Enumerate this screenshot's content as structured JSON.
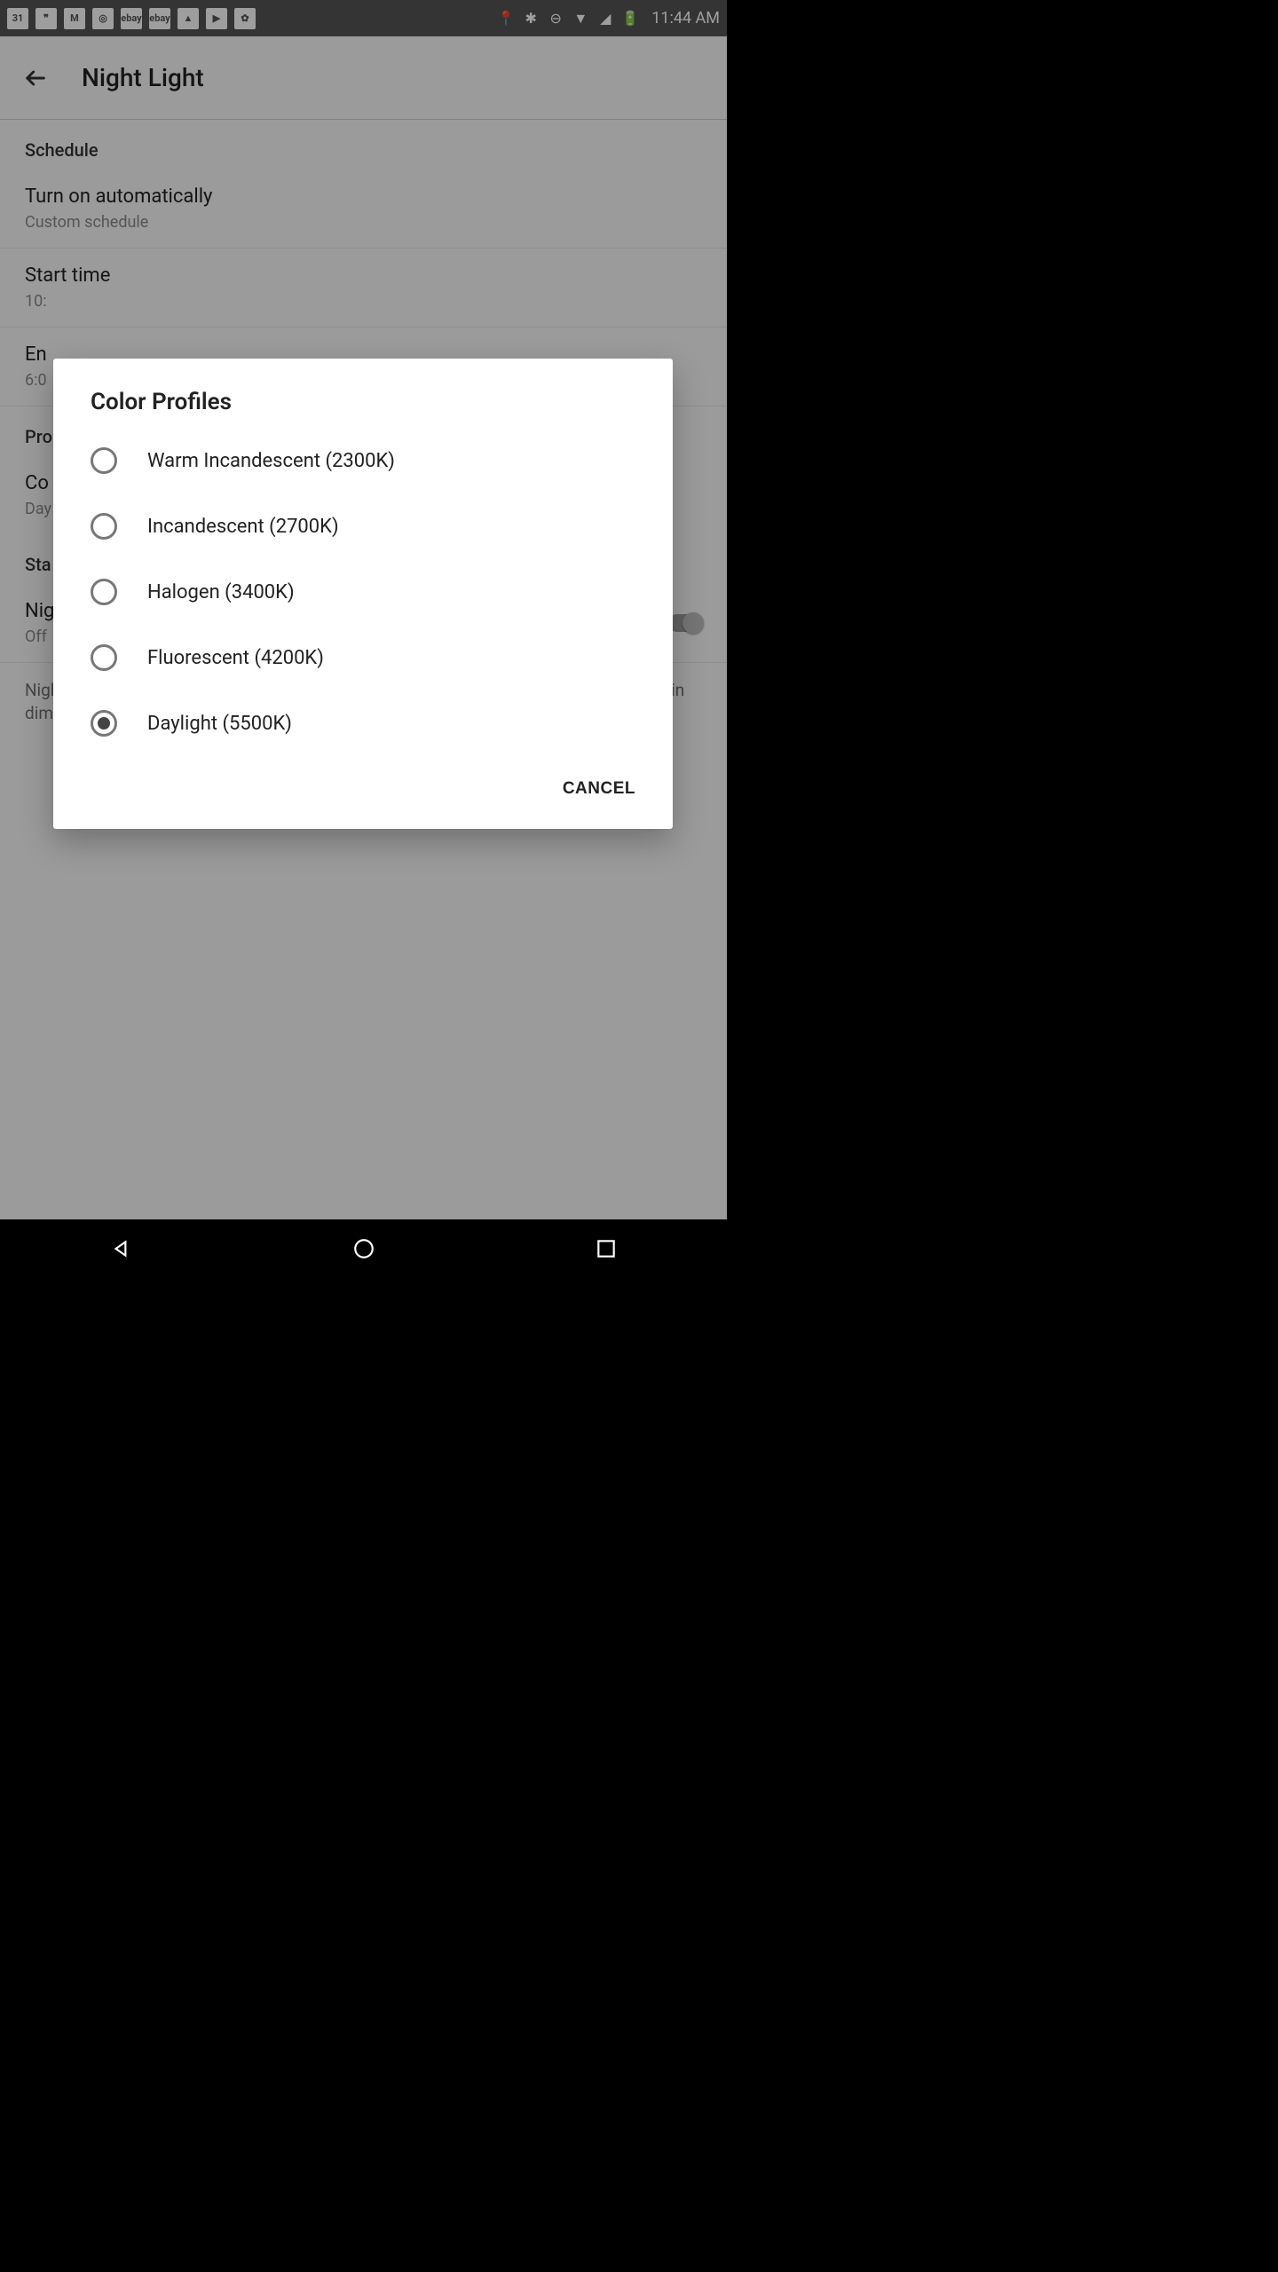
{
  "status": {
    "time": "11:44 AM",
    "left_icons": [
      "31",
      "❞",
      "M",
      "◎",
      "ebay",
      "ebay",
      "▲",
      "▶",
      "✿"
    ],
    "right_icons": [
      "📍",
      "✱",
      "⊖",
      "▼",
      "◢",
      "🔋"
    ]
  },
  "header": {
    "title": "Night Light"
  },
  "settings": {
    "section_schedule": "Schedule",
    "auto_title": "Turn on automatically",
    "auto_sub": "Custom schedule",
    "start_title": "Start time",
    "start_sub": "10:",
    "end_title": "En",
    "end_sub": "6:0",
    "pro_label": "Pro",
    "co_title": "Co",
    "co_sub": "Day",
    "sta_label": "Sta",
    "night_title": "Nig",
    "night_sub": "Off",
    "desc": "Night Light tints your screen amber. This makes it easier to look at your screen or read in dim light, and may help you fall asleep more easily."
  },
  "dialog": {
    "title": "Color Profiles",
    "options": [
      {
        "label": "Warm Incandescent (2300K)",
        "checked": false
      },
      {
        "label": "Incandescent (2700K)",
        "checked": false
      },
      {
        "label": "Halogen (3400K)",
        "checked": false
      },
      {
        "label": "Fluorescent (4200K)",
        "checked": false
      },
      {
        "label": "Daylight (5500K)",
        "checked": true
      }
    ],
    "cancel": "CANCEL"
  }
}
